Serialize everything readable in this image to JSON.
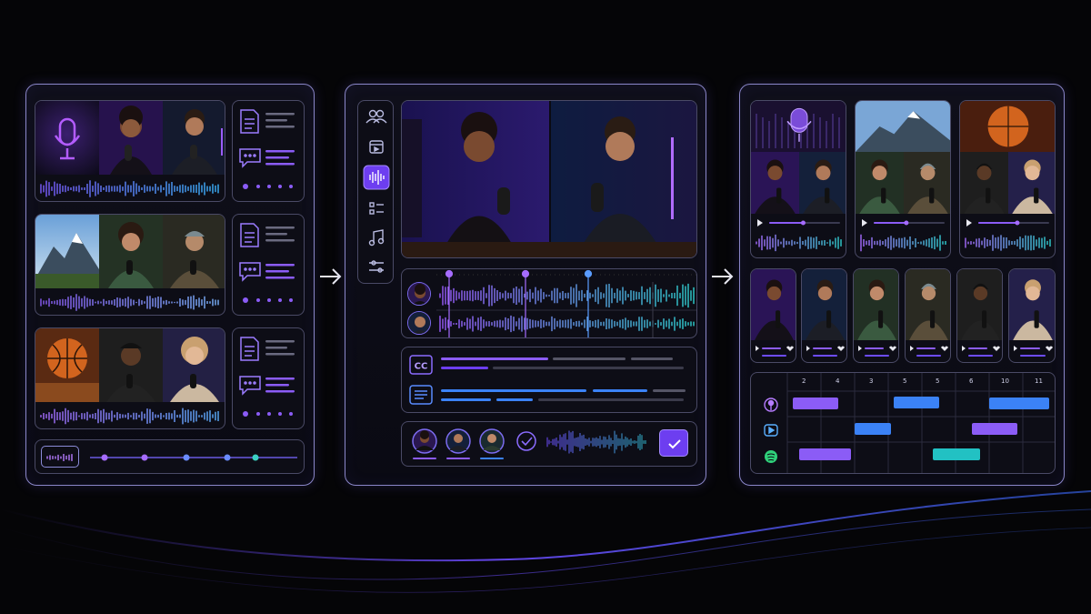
{
  "timeline": {
    "ticks": [
      "2",
      "4",
      "3",
      "5",
      "5",
      "6",
      "10",
      "11"
    ]
  },
  "icons": {
    "mic": "microphone-icon",
    "doc": "document-icon",
    "chat": "chat-bubble-icon",
    "users": "users-icon",
    "calendar": "calendar-icon",
    "audio": "audio-waveform-icon",
    "checklist": "checklist-icon",
    "music": "music-note-icon",
    "sliders": "sliders-icon",
    "cc": "closed-captions-icon",
    "transcript": "transcript-icon",
    "check": "check-icon",
    "podcast": "podcast-icon",
    "youtube": "video-platform-icon",
    "spotify": "spotify-icon",
    "play": "play-icon",
    "heart": "heart-icon",
    "arrow": "arrow-right-icon"
  },
  "colors": {
    "accent_purple": "#8b5cf6",
    "accent_blue": "#3b82f6",
    "accent_teal": "#22c1c3",
    "panel_border": "#8a86c8"
  }
}
